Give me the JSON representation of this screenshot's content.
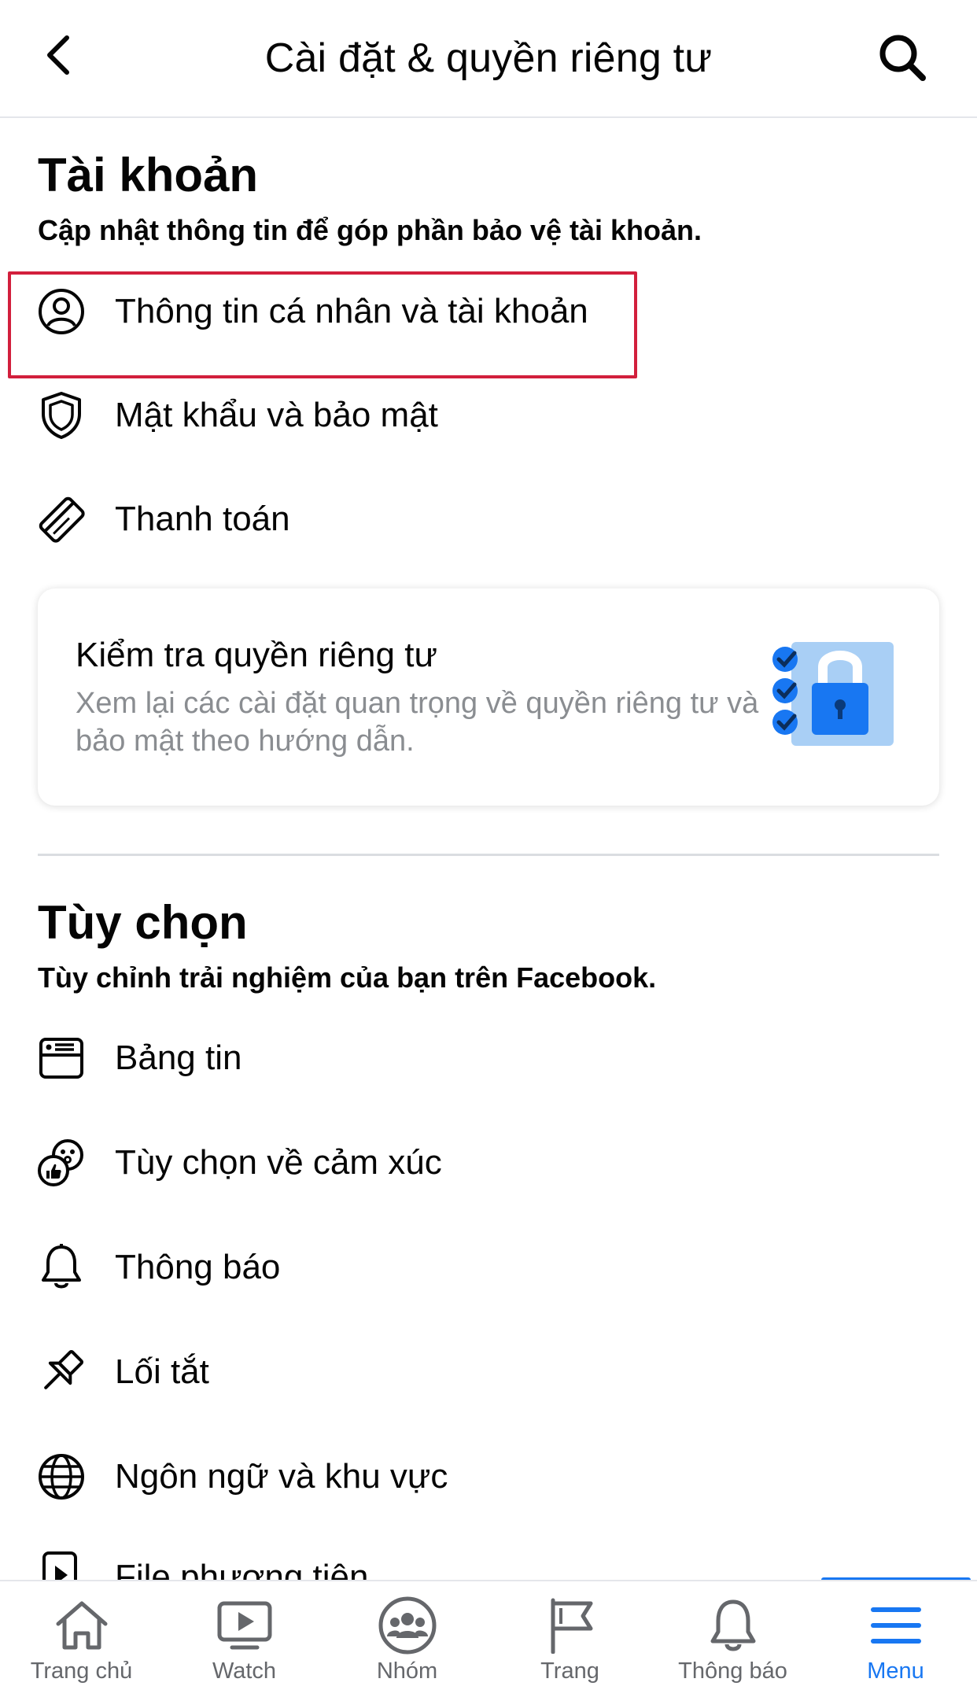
{
  "header": {
    "title": "Cài đặt & quyền riêng tư",
    "back_icon": "chevron-left-icon",
    "search_icon": "search-icon"
  },
  "account": {
    "title": "Tài khoản",
    "subtitle": "Cập nhật thông tin để góp phần bảo vệ tài khoản.",
    "items": [
      {
        "label": "Thông tin cá nhân và tài khoản",
        "icon": "user-circle-icon"
      },
      {
        "label": "Mật khẩu và bảo mật",
        "icon": "shield-icon"
      },
      {
        "label": "Thanh toán",
        "icon": "credit-card-icon"
      }
    ]
  },
  "privacy_card": {
    "title": "Kiểm tra quyền riêng tư",
    "description": "Xem lại các cài đặt quan trọng về quyền riêng tư và bảo mật theo hướng dẫn.",
    "icon": "privacy-checkup-lock-icon"
  },
  "preferences": {
    "title": "Tùy chọn",
    "subtitle": "Tùy chỉnh trải nghiệm của bạn trên Facebook.",
    "items": [
      {
        "label": "Bảng tin",
        "icon": "news-feed-icon"
      },
      {
        "label": "Tùy chọn về cảm xúc",
        "icon": "reactions-icon"
      },
      {
        "label": "Thông báo",
        "icon": "bell-icon"
      },
      {
        "label": "Lối tắt",
        "icon": "pin-icon"
      },
      {
        "label": "Ngôn ngữ và khu vực",
        "icon": "globe-icon"
      },
      {
        "label": "File phương tiện",
        "icon": "media-file-icon"
      }
    ]
  },
  "bottom_nav": {
    "items": [
      {
        "label": "Trang chủ",
        "icon": "home-icon"
      },
      {
        "label": "Watch",
        "icon": "watch-icon"
      },
      {
        "label": "Nhóm",
        "icon": "groups-icon"
      },
      {
        "label": "Trang",
        "icon": "flag-icon"
      },
      {
        "label": "Thông báo",
        "icon": "bell-icon"
      },
      {
        "label": "Menu",
        "icon": "menu-icon"
      }
    ],
    "active": "Menu"
  },
  "colors": {
    "accent": "#1877f2",
    "highlight_border": "#d21f3c",
    "secondary_text": "#8a8d91"
  }
}
